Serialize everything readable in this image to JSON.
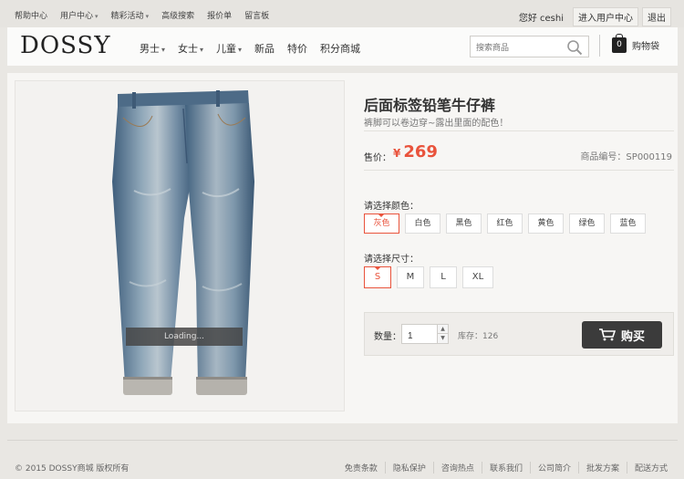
{
  "topnav": {
    "items": [
      {
        "label": "帮助中心",
        "dropdown": false
      },
      {
        "label": "用户中心",
        "dropdown": true
      },
      {
        "label": "精彩活动",
        "dropdown": true
      },
      {
        "label": "高级搜索",
        "dropdown": false
      },
      {
        "label": "报价单",
        "dropdown": false
      },
      {
        "label": "留言板",
        "dropdown": false
      }
    ],
    "greeting": "您好 ceshi",
    "user_center_button": "进入用户中心",
    "logout_button": "退出"
  },
  "header": {
    "logo": "DOSSY",
    "nav": [
      {
        "label": "男士",
        "dropdown": true
      },
      {
        "label": "女士",
        "dropdown": true
      },
      {
        "label": "儿童",
        "dropdown": true
      },
      {
        "label": "新品",
        "dropdown": false
      },
      {
        "label": "特价",
        "dropdown": false
      },
      {
        "label": "积分商城",
        "dropdown": false
      }
    ],
    "search_placeholder": "搜索商品",
    "cart_count": "0",
    "cart_label": "购物袋"
  },
  "product": {
    "loading_text": "Loading...",
    "title": "后面标签铅笔牛仔裤",
    "subtitle": "裤脚可以卷边穿~露出里面的配色！",
    "price_label": "售价：",
    "currency": "¥",
    "price": "269",
    "sku": "商品编号：SP000119",
    "color_label": "请选择颜色：",
    "colors": [
      "灰色",
      "白色",
      "黑色",
      "红色",
      "黄色",
      "绿色",
      "蓝色"
    ],
    "selected_color": "灰色",
    "size_label": "请选择尺寸：",
    "sizes": [
      "S",
      "M",
      "L",
      "XL"
    ],
    "selected_size": "S",
    "qty_label": "数量：",
    "qty": "1",
    "stock": "库存：126",
    "buy_label": "购买",
    "accent_color": "#e9533c"
  },
  "footer": {
    "copyright": "© 2015 DOSSY商城 版权所有",
    "links": [
      "免责条款",
      "隐私保护",
      "咨询热点",
      "联系我们",
      "公司简介",
      "批发方案",
      "配送方式"
    ]
  }
}
